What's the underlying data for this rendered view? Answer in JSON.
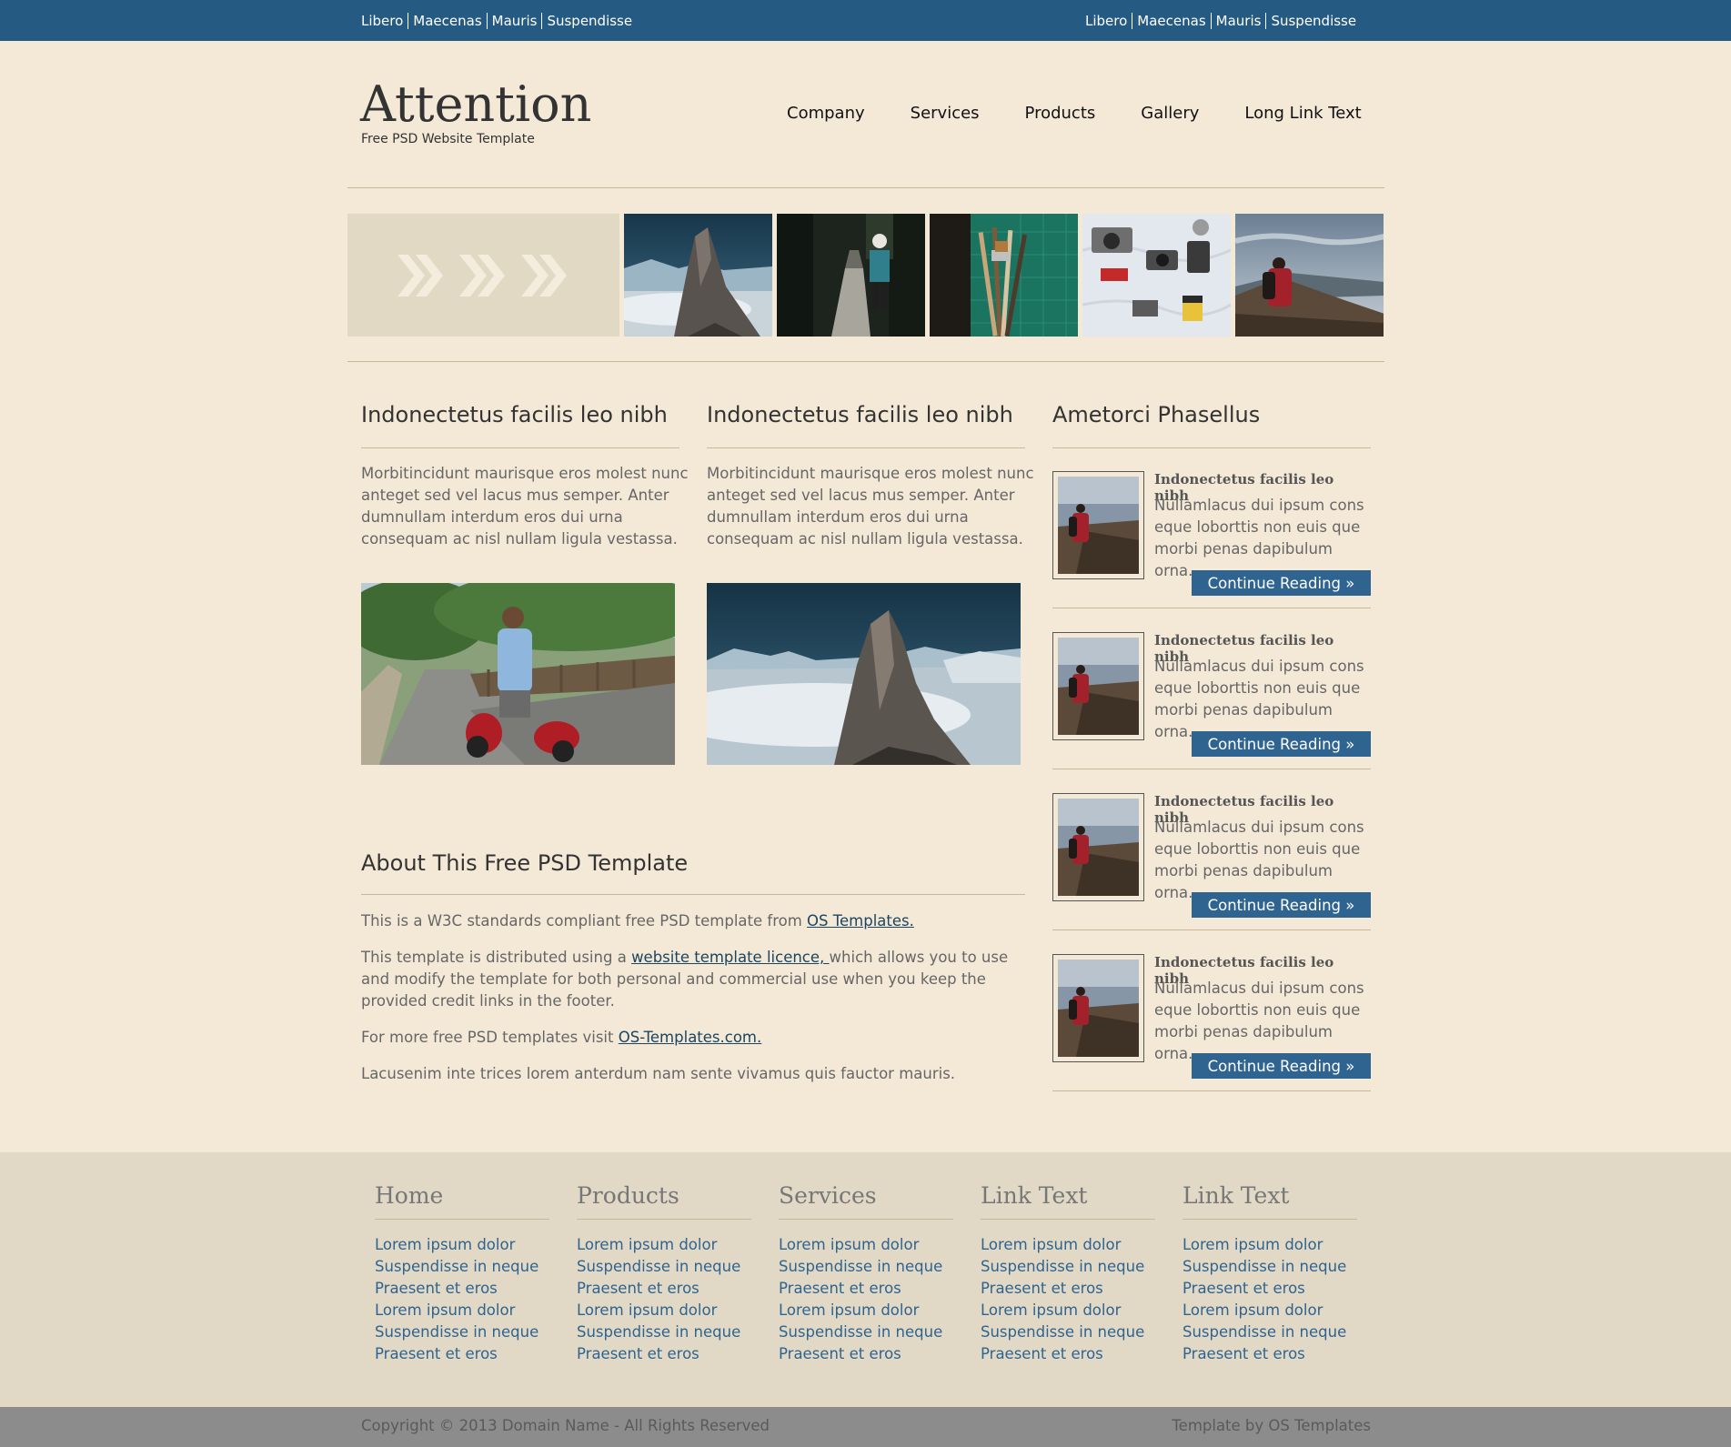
{
  "topbar": {
    "left_links": [
      "Libero",
      "Maecenas",
      "Mauris",
      "Suspendisse"
    ],
    "right_links": [
      "Libero",
      "Maecenas",
      "Mauris",
      "Suspendisse"
    ]
  },
  "header": {
    "logo": "Attention",
    "tagline": "Free PSD Website Template",
    "nav": [
      "Company",
      "Services",
      "Products",
      "Gallery",
      "Long Link Text"
    ]
  },
  "columns": [
    {
      "title": "Indonectetus facilis leo nibh",
      "text": "Morbitincidunt maurisque eros molest nunc anteget sed vel lacus mus semper. Anter dumnullam interdum eros dui urna consequam ac nisl nullam ligula vestassa."
    },
    {
      "title": "Indonectetus facilis leo nibh",
      "text": "Morbitincidunt maurisque eros molest nunc anteget sed vel lacus mus semper. Anter dumnullam interdum eros dui urna consequam ac nisl nullam ligula vestassa."
    }
  ],
  "about": {
    "title": "About This Free PSD Template",
    "p1_text": "This is a W3C standards compliant free PSD template from ",
    "p1_link": "OS Templates.",
    "p2_text_a": "This template is distributed using a ",
    "p2_link": "website template licence, ",
    "p2_text_b": "which allows you to use and modify the template for both personal and commercial use when you keep the provided credit links in the footer.",
    "p3_text": "For more free PSD templates visit ",
    "p3_link": "OS-Templates.com.",
    "p4_text": "Lacusenim inte trices lorem anterdum nam sente vivamus quis fauctor mauris."
  },
  "sidebar": {
    "title": "Ametorci Phasellus",
    "posts": [
      {
        "title": "Indonectetus facilis leo nibh",
        "text": "Nullamlacus dui ipsum cons eque loborttis non euis que morbi penas dapibulum orna.",
        "button": "Continue Reading »"
      },
      {
        "title": "Indonectetus facilis leo nibh",
        "text": "Nullamlacus dui ipsum cons eque loborttis non euis que morbi penas dapibulum orna.",
        "button": "Continue Reading »"
      },
      {
        "title": "Indonectetus facilis leo nibh",
        "text": "Nullamlacus dui ipsum cons eque loborttis non euis que morbi penas dapibulum orna.",
        "button": "Continue Reading »"
      },
      {
        "title": "Indonectetus facilis leo nibh",
        "text": "Nullamlacus dui ipsum cons eque loborttis non euis que morbi penas dapibulum orna.",
        "button": "Continue Reading »"
      }
    ]
  },
  "footer": {
    "columns": [
      {
        "heading": "Home",
        "links": [
          "Lorem ipsum dolor",
          "Suspendisse in neque",
          "Praesent et eros",
          "Lorem ipsum dolor",
          "Suspendisse in neque",
          "Praesent et eros"
        ]
      },
      {
        "heading": "Products",
        "links": [
          "Lorem ipsum dolor",
          "Suspendisse in neque",
          "Praesent et eros",
          "Lorem ipsum dolor",
          "Suspendisse in neque",
          "Praesent et eros"
        ]
      },
      {
        "heading": "Services",
        "links": [
          "Lorem ipsum dolor",
          "Suspendisse in neque",
          "Praesent et eros",
          "Lorem ipsum dolor",
          "Suspendisse in neque",
          "Praesent et eros"
        ]
      },
      {
        "heading": "Link Text",
        "links": [
          "Lorem ipsum dolor",
          "Suspendisse in neque",
          "Praesent et eros",
          "Lorem ipsum dolor",
          "Suspendisse in neque",
          "Praesent et eros"
        ]
      },
      {
        "heading": "Link Text",
        "links": [
          "Lorem ipsum dolor",
          "Suspendisse in neque",
          "Praesent et eros",
          "Lorem ipsum dolor",
          "Suspendisse in neque",
          "Praesent et eros"
        ]
      }
    ],
    "copyright": "Copyright © 2013 Domain Name - All Rights Reserved",
    "credit": "Template by OS Templates"
  },
  "colors": {
    "topbar": "#255a82",
    "page_bg": "#f4e9d7",
    "button": "#2f6490",
    "footer_bg": "#e1d8c5",
    "copy_bg": "#8c8c8c"
  }
}
